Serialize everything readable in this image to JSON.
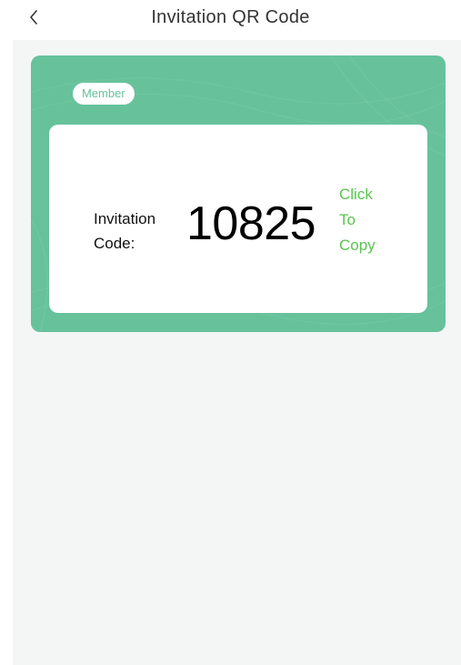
{
  "header": {
    "back_icon": "chevron-left-icon",
    "title": "Invitation QR Code"
  },
  "card": {
    "badge": "Member",
    "code_label_line1": "Invitation",
    "code_label_line2": "Code:",
    "code_value": "10825",
    "copy_line1": "Click",
    "copy_line2": "To",
    "copy_line3": "Copy"
  },
  "colors": {
    "card_green": "#67c29c",
    "copy_green": "#5ac44e",
    "background": "#f4f6f5"
  }
}
